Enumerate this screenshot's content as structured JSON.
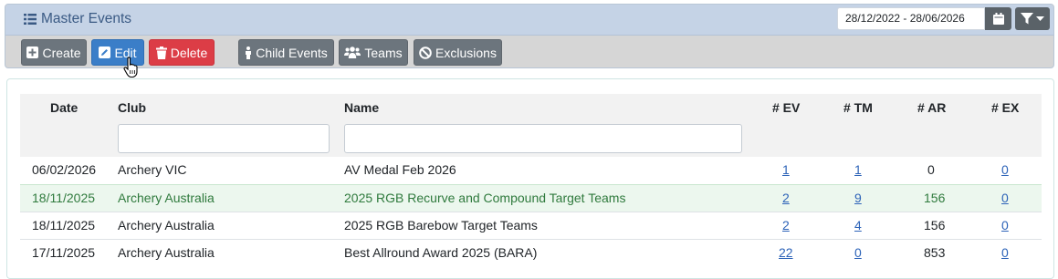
{
  "header": {
    "title": "Master Events",
    "date_range": "28/12/2022 - 28/06/2026"
  },
  "toolbar": {
    "create": "Create",
    "edit": "Edit",
    "delete": "Delete",
    "child_events": "Child Events",
    "teams": "Teams",
    "exclusions": "Exclusions"
  },
  "table": {
    "columns": {
      "date": "Date",
      "club": "Club",
      "name": "Name",
      "ev": "# EV",
      "tm": "# TM",
      "ar": "# AR",
      "ex": "# EX"
    },
    "rows": [
      {
        "date": "06/02/2026",
        "club": "Archery VIC",
        "name": "AV Medal Feb 2026",
        "ev": "1",
        "tm": "1",
        "ar": "0",
        "ex": "0"
      },
      {
        "date": "18/11/2025",
        "club": "Archery Australia",
        "name": "2025 RGB Recurve and Compound Target Teams",
        "ev": "2",
        "tm": "9",
        "ar": "156",
        "ex": "0"
      },
      {
        "date": "18/11/2025",
        "club": "Archery Australia",
        "name": "2025 RGB Barebow Target Teams",
        "ev": "2",
        "tm": "4",
        "ar": "156",
        "ex": "0"
      },
      {
        "date": "17/11/2025",
        "club": "Archery Australia",
        "name": "Best Allround Award 2025 (BARA)",
        "ev": "22",
        "tm": "0",
        "ar": "853",
        "ex": "0"
      }
    ]
  }
}
